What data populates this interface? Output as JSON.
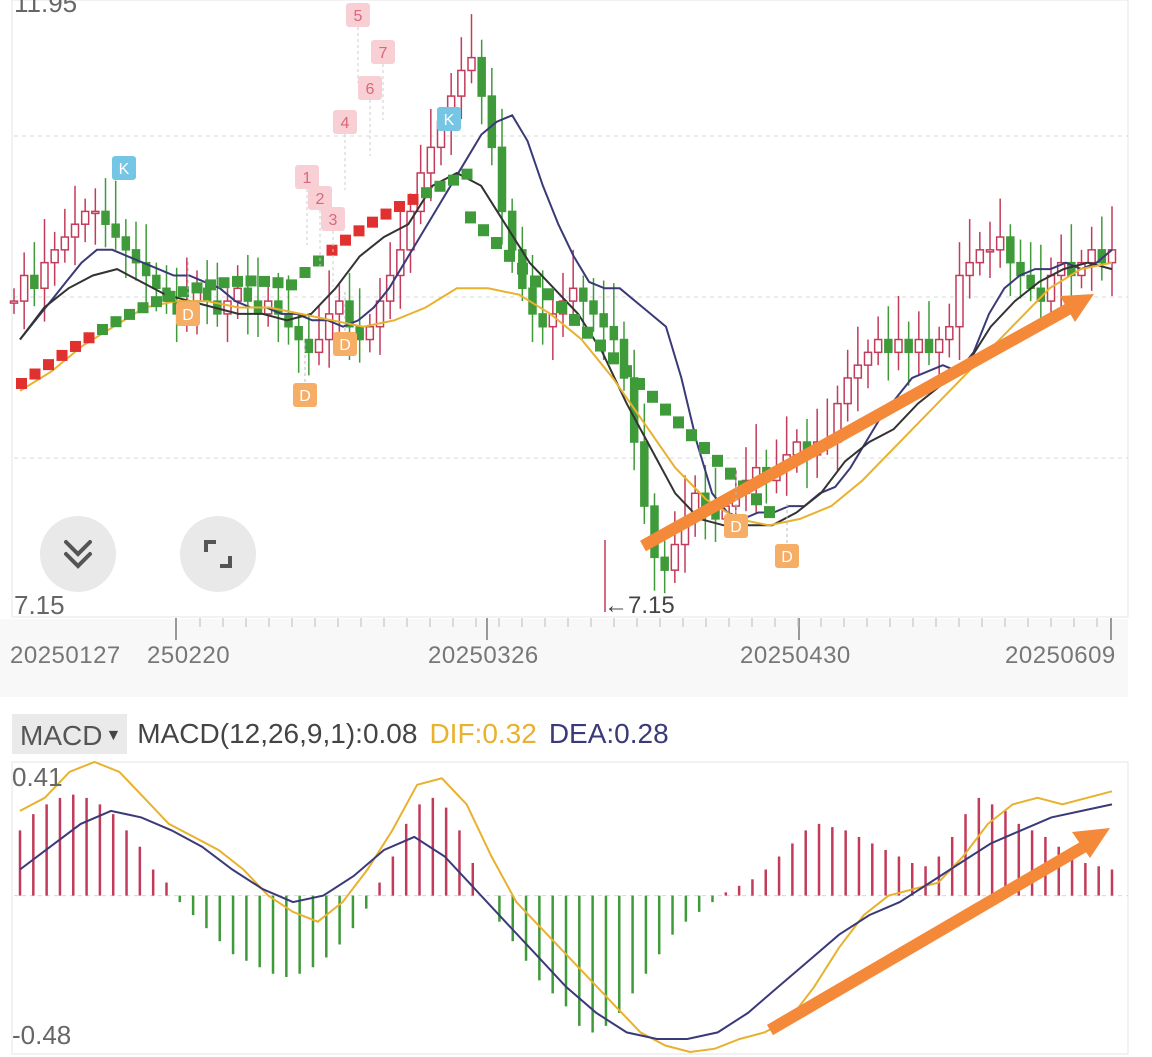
{
  "price_axis": {
    "top_label": "11.95",
    "low_label": "7.15",
    "low_pointer": "←7.15"
  },
  "date_axis": [
    "20250127",
    "250220",
    "20250326",
    "20250430",
    "20250609"
  ],
  "buttons": {
    "collapse": "chevrons-down-icon",
    "fullscreen": "fullscreen-icon"
  },
  "markers": {
    "k": "K",
    "d": "D",
    "nums": [
      "1",
      "2",
      "3",
      "4",
      "5",
      "6",
      "7"
    ]
  },
  "macd": {
    "select_label": "MACD",
    "params_text": "MACD(12,26,9,1):0.08",
    "dif_text": "DIF:0.32",
    "dea_text": "DEA:0.28",
    "max_label": "0.41",
    "min_label": "-0.48"
  },
  "colors": {
    "up": "#c23b5a",
    "down": "#3f9a3a",
    "bright_up": "#e03030",
    "dif": "#e8b12e",
    "dea": "#3b3a78",
    "ma_dark": "#333333",
    "arrow": "#f5893a",
    "k_badge": "#74c6e4",
    "d_badge": "#f6ad66",
    "num_badge": "#f8cfd4"
  },
  "chart_data": [
    {
      "type": "candlestick",
      "title": "",
      "ylim": [
        7.15,
        11.95
      ],
      "x_ticks": [
        "20250127",
        "250220",
        "20250326",
        "20250430",
        "20250609"
      ],
      "low": 7.15,
      "closes": [
        9.6,
        9.8,
        9.7,
        9.9,
        10.0,
        10.1,
        10.2,
        10.3,
        10.3,
        10.2,
        10.1,
        10.0,
        9.9,
        9.8,
        9.7,
        9.6,
        9.5,
        9.6,
        9.7,
        9.6,
        9.5,
        9.6,
        9.7,
        9.6,
        9.5,
        9.6,
        9.5,
        9.4,
        9.3,
        9.2,
        9.3,
        9.5,
        9.6,
        9.4,
        9.3,
        9.4,
        9.6,
        9.8,
        10.0,
        10.3,
        10.6,
        10.8,
        11.0,
        11.2,
        11.4,
        11.5,
        11.2,
        10.8,
        10.3,
        10.0,
        9.7,
        9.5,
        9.4,
        9.5,
        9.6,
        9.7,
        9.6,
        9.5,
        9.4,
        9.3,
        9.0,
        8.5,
        8.0,
        7.6,
        7.5,
        7.7,
        7.9,
        8.1,
        8.0,
        7.9,
        8.0,
        8.1,
        8.2,
        8.3,
        8.2,
        8.3,
        8.4,
        8.5,
        8.4,
        8.5,
        8.5,
        8.8,
        9.0,
        9.1,
        9.2,
        9.3,
        9.2,
        9.3,
        9.2,
        9.3,
        9.2,
        9.3,
        9.4,
        9.8,
        9.9,
        10.0,
        10.0,
        10.1,
        9.9,
        9.8,
        9.7,
        9.6,
        9.8,
        9.9,
        9.8,
        9.9,
        10.0,
        9.9,
        10.0
      ],
      "series": [
        {
          "name": "",
          "values": [
            9.3,
            9.45,
            9.6,
            9.75,
            9.9,
            10.0,
            10.0,
            9.95,
            9.9,
            9.85,
            9.8,
            9.8,
            9.75,
            9.7,
            9.6,
            9.55,
            9.55,
            9.5,
            9.5,
            9.45,
            9.45,
            9.4,
            9.45,
            9.55,
            9.7,
            9.9,
            10.1,
            10.3,
            10.5,
            10.7,
            10.9,
            11.0,
            11.05,
            10.85,
            10.5,
            10.2,
            9.95,
            9.75,
            9.7,
            9.7,
            9.6,
            9.5,
            9.4,
            9.0,
            8.5,
            8.1,
            7.95,
            7.9,
            7.95,
            7.95,
            8.0,
            8.0,
            8.1,
            8.15,
            8.3,
            8.5,
            8.7,
            8.85,
            9.0,
            9.05,
            9.1,
            9.05,
            9.2,
            9.5,
            9.7,
            9.8,
            9.85,
            9.85,
            9.9,
            9.85,
            9.9,
            10.0
          ]
        },
        {
          "name": "",
          "values": [
            9.3,
            9.55,
            9.7,
            9.8,
            9.85,
            9.75,
            9.65,
            9.6,
            9.55,
            9.5,
            9.5,
            9.45,
            9.5,
            9.7,
            9.95,
            10.1,
            10.2,
            10.5,
            10.6,
            10.5,
            10.2,
            9.9,
            9.7,
            9.5,
            9.2,
            8.8,
            8.45,
            8.1,
            7.9,
            7.85,
            7.85,
            7.85,
            7.95,
            8.1,
            8.35,
            8.5,
            8.6,
            8.8,
            8.95,
            9.1,
            9.4,
            9.6,
            9.75,
            9.85,
            9.9,
            9.85
          ]
        },
        {
          "name": "",
          "values": [
            8.9,
            9.05,
            9.25,
            9.4,
            9.55,
            9.6,
            9.6,
            9.55,
            9.55,
            9.5,
            9.45,
            9.4,
            9.45,
            9.55,
            9.7,
            9.7,
            9.65,
            9.5,
            9.3,
            9.0,
            8.65,
            8.3,
            8.05,
            7.9,
            7.85,
            7.9,
            8.0,
            8.2,
            8.45,
            8.7,
            8.95,
            9.2,
            9.45,
            9.7,
            9.85,
            9.9
          ]
        }
      ],
      "annotation": "←7.15"
    },
    {
      "type": "bar",
      "title": "MACD(12,26,9,1):0.08",
      "ylim": [
        -0.48,
        0.41
      ],
      "histogram": [
        0.2,
        0.25,
        0.28,
        0.3,
        0.31,
        0.3,
        0.28,
        0.25,
        0.2,
        0.15,
        0.08,
        0.04,
        -0.02,
        -0.06,
        -0.1,
        -0.14,
        -0.18,
        -0.2,
        -0.22,
        -0.24,
        -0.25,
        -0.24,
        -0.22,
        -0.19,
        -0.15,
        -0.1,
        -0.04,
        0.04,
        0.12,
        0.22,
        0.28,
        0.3,
        0.27,
        0.2,
        0.1,
        0.0,
        -0.08,
        -0.14,
        -0.2,
        -0.26,
        -0.3,
        -0.34,
        -0.4,
        -0.42,
        -0.4,
        -0.36,
        -0.3,
        -0.24,
        -0.18,
        -0.12,
        -0.08,
        -0.05,
        -0.02,
        0.01,
        0.03,
        0.05,
        0.08,
        0.12,
        0.16,
        0.2,
        0.22,
        0.21,
        0.2,
        0.18,
        0.16,
        0.14,
        0.12,
        0.1,
        0.09,
        0.12,
        0.18,
        0.25,
        0.3,
        0.28,
        0.26,
        0.22,
        0.2,
        0.18,
        0.15,
        0.12,
        0.1,
        0.09,
        0.08
      ],
      "series": [
        {
          "name": "DIF",
          "values": [
            0.26,
            0.3,
            0.38,
            0.41,
            0.38,
            0.3,
            0.22,
            0.18,
            0.14,
            0.08,
            0.0,
            -0.05,
            -0.08,
            -0.02,
            0.08,
            0.2,
            0.34,
            0.36,
            0.28,
            0.12,
            -0.02,
            -0.1,
            -0.18,
            -0.26,
            -0.34,
            -0.42,
            -0.46,
            -0.48,
            -0.47,
            -0.44,
            -0.42,
            -0.38,
            -0.28,
            -0.16,
            -0.06,
            0.0,
            0.02,
            0.04,
            0.12,
            0.22,
            0.28,
            0.3,
            0.28,
            0.3,
            0.32
          ]
        },
        {
          "name": "DEA",
          "values": [
            0.08,
            0.15,
            0.22,
            0.26,
            0.24,
            0.2,
            0.15,
            0.08,
            0.02,
            -0.02,
            0.0,
            0.06,
            0.14,
            0.18,
            0.12,
            0.02,
            -0.08,
            -0.18,
            -0.28,
            -0.36,
            -0.42,
            -0.44,
            -0.44,
            -0.42,
            -0.36,
            -0.28,
            -0.2,
            -0.12,
            -0.06,
            -0.02,
            0.04,
            0.1,
            0.16,
            0.2,
            0.24,
            0.26,
            0.28
          ]
        }
      ],
      "legend": [
        "MACD(12,26,9,1):0.08",
        "DIF:0.32",
        "DEA:0.28"
      ]
    }
  ]
}
